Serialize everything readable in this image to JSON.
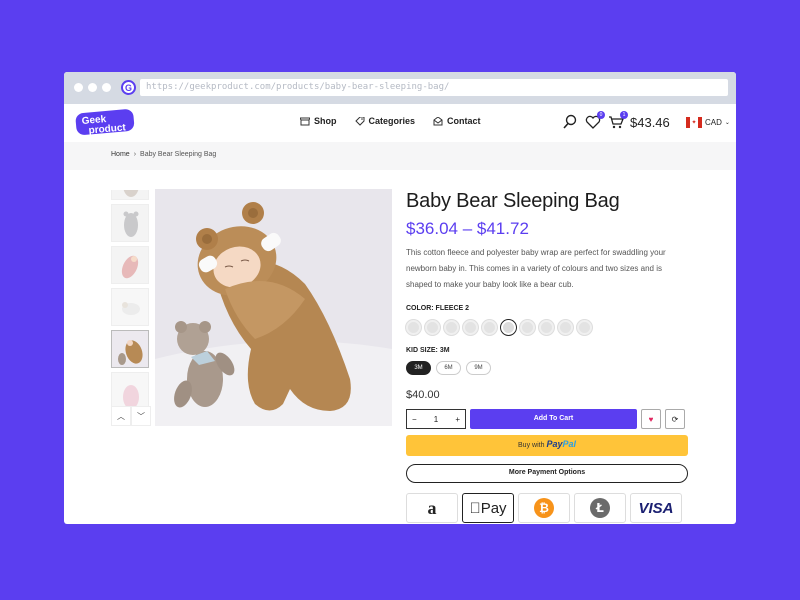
{
  "browser": {
    "url": "https://geekproduct.com/products/baby-bear-sleeping-bag/"
  },
  "header": {
    "logo_line1": "Geek",
    "logo_line2": "product",
    "nav": [
      {
        "label": "Shop",
        "icon": "shop-icon"
      },
      {
        "label": "Categories",
        "icon": "tag-icon"
      },
      {
        "label": "Contact",
        "icon": "mail-icon"
      }
    ],
    "wishlist_count": "0",
    "cart_count": "1",
    "cart_total": "$43.46",
    "currency": "CAD"
  },
  "breadcrumb": {
    "home": "Home",
    "separator": "›",
    "current": "Baby Bear Sleeping Bag"
  },
  "product": {
    "title": "Baby Bear Sleeping Bag",
    "price_range": "$36.04 – $41.72",
    "description": "This cotton fleece and polyester baby wrap are perfect for swaddling your newborn baby in. This comes in a variety of colours and two sizes and is shaped to make your baby look like a bear cub.",
    "color_label": "COLOR: FLEECE 2",
    "color_count": 10,
    "selected_color_index": 5,
    "size_label": "KID SIZE: 3M",
    "sizes": [
      "3M",
      "6M",
      "9M"
    ],
    "selected_size": "3M",
    "total_price": "$40.00",
    "quantity": "1",
    "qty_minus": "−",
    "qty_plus": "+",
    "add_to_cart": "Add To Cart",
    "paypal_prefix": "Buy with",
    "paypal_brand_a": "Pay",
    "paypal_brand_b": "Pal",
    "more_payment": "More Payment Options"
  },
  "payment_methods": [
    "amazon-pay-icon",
    "apple-pay-icon",
    "bitcoin-icon",
    "litecoin-icon",
    "visa-icon"
  ],
  "payment_labels": {
    "amazon": "a",
    "apple": "Pay",
    "bitcoin": "₿",
    "litecoin": "Ł",
    "visa": "VISA"
  },
  "colors": {
    "accent": "#5b3ef0",
    "paypal": "#ffc439",
    "background": "#5b3ef0"
  }
}
